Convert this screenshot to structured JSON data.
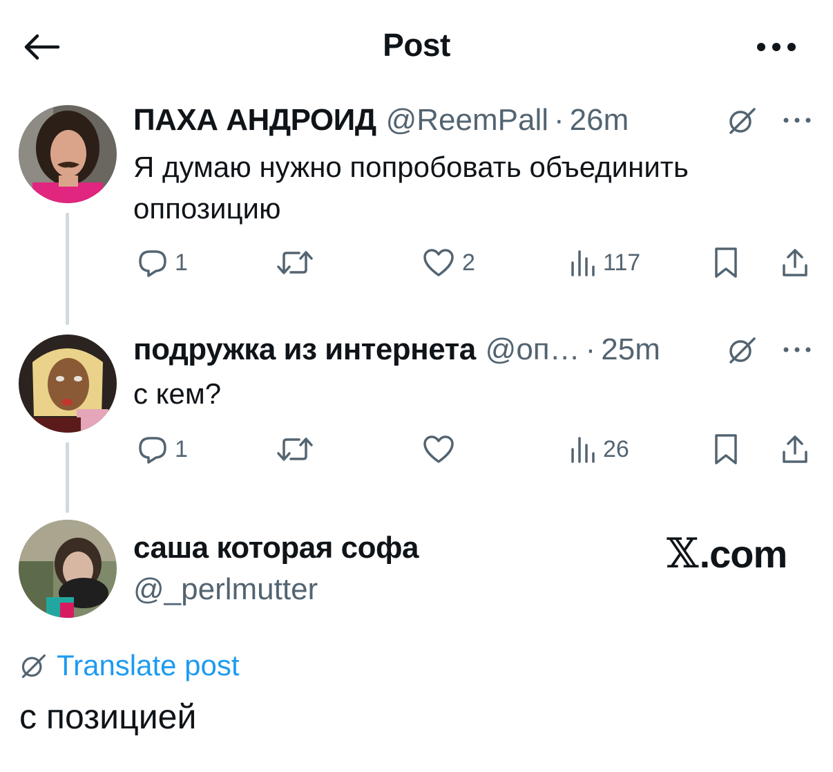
{
  "header": {
    "title": "Post",
    "back_icon": "arrow-left-icon",
    "more_icon": "more-horizontal-icon"
  },
  "tweets": [
    {
      "name": "ПАХА АНДРОИД",
      "handle": "@ReemPall",
      "dot": "·",
      "time": "26m",
      "text": "Я думаю нужно попробовать объединить оппозицию",
      "replies": "1",
      "reposts": "",
      "likes": "2",
      "views": "117"
    },
    {
      "name": "подружка из интернета",
      "handle": "@оп…",
      "dot": "·",
      "time": "25m",
      "text": "с кем?",
      "replies": "1",
      "reposts": "",
      "likes": "",
      "views": "26"
    }
  ],
  "main_post": {
    "name": "саша которая софа",
    "handle": "@_perlmutter",
    "translate_label": "Translate post",
    "text": "с позицией"
  },
  "watermark": {
    "mark": "𝕏",
    "suffix": ".com"
  },
  "colors": {
    "text": "#0f1419",
    "secondary": "#536471",
    "link": "#1d9bf0",
    "thread_line": "#cfd9de"
  }
}
